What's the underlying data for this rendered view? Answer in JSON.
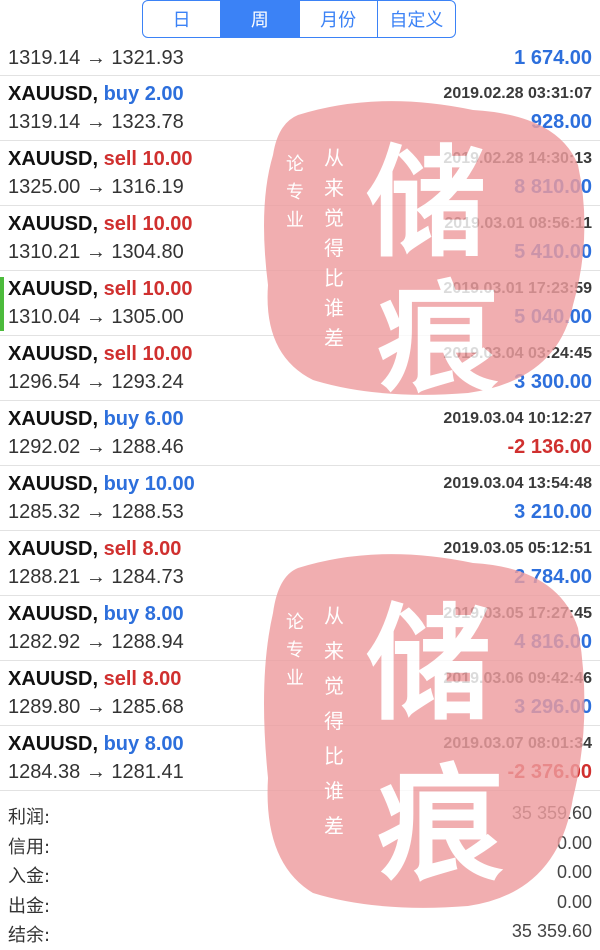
{
  "tabs": [
    "日",
    "周",
    "月份",
    "自定义"
  ],
  "active_tab": 1,
  "first_row": {
    "prices": "1319.14 → 1321.93",
    "profit": "1 674.00"
  },
  "trades": [
    {
      "symbol": "XAUUSD,",
      "action": "buy",
      "lots": "2.00",
      "time": "2019.02.28 03:31:07",
      "open": "1319.14",
      "close": "1323.78",
      "profit": "928.00",
      "sign": "pos"
    },
    {
      "symbol": "XAUUSD,",
      "action": "sell",
      "lots": "10.00",
      "time": "2019.02.28 14:30:13",
      "open": "1325.00",
      "close": "1316.19",
      "profit": "8 810.00",
      "sign": "pos"
    },
    {
      "symbol": "XAUUSD,",
      "action": "sell",
      "lots": "10.00",
      "time": "2019.03.01 08:56:11",
      "open": "1310.21",
      "close": "1304.80",
      "profit": "5 410.00",
      "sign": "pos"
    },
    {
      "symbol": "XAUUSD,",
      "action": "sell",
      "lots": "10.00",
      "time": "2019.03.01 17:23:59",
      "open": "1310.04",
      "close": "1305.00",
      "profit": "5 040.00",
      "sign": "pos",
      "selected": true
    },
    {
      "symbol": "XAUUSD,",
      "action": "sell",
      "lots": "10.00",
      "time": "2019.03.04 03:24:45",
      "open": "1296.54",
      "close": "1293.24",
      "profit": "3 300.00",
      "sign": "pos"
    },
    {
      "symbol": "XAUUSD,",
      "action": "buy",
      "lots": "6.00",
      "time": "2019.03.04 10:12:27",
      "open": "1292.02",
      "close": "1288.46",
      "profit": "-2 136.00",
      "sign": "neg"
    },
    {
      "symbol": "XAUUSD,",
      "action": "buy",
      "lots": "10.00",
      "time": "2019.03.04 13:54:48",
      "open": "1285.32",
      "close": "1288.53",
      "profit": "3 210.00",
      "sign": "pos"
    },
    {
      "symbol": "XAUUSD,",
      "action": "sell",
      "lots": "8.00",
      "time": "2019.03.05 05:12:51",
      "open": "1288.21",
      "close": "1284.73",
      "profit": "2 784.00",
      "sign": "pos"
    },
    {
      "symbol": "XAUUSD,",
      "action": "buy",
      "lots": "8.00",
      "time": "2019.03.05 17:27:45",
      "open": "1282.92",
      "close": "1288.94",
      "profit": "4 816.00",
      "sign": "pos"
    },
    {
      "symbol": "XAUUSD,",
      "action": "sell",
      "lots": "8.00",
      "time": "2019.03.06 09:42:46",
      "open": "1289.80",
      "close": "1285.68",
      "profit": "3 296.00",
      "sign": "pos"
    },
    {
      "symbol": "XAUUSD,",
      "action": "buy",
      "lots": "8.00",
      "time": "2019.03.07 08:01:34",
      "open": "1284.38",
      "close": "1281.41",
      "profit": "-2 376.00",
      "sign": "neg"
    }
  ],
  "summary": [
    {
      "label": "利润:",
      "value": "35 359.60"
    },
    {
      "label": "信用:",
      "value": "0.00"
    },
    {
      "label": "入金:",
      "value": "0.00"
    },
    {
      "label": "出金:",
      "value": "0.00"
    },
    {
      "label": "结余:",
      "value": "35 359.60"
    }
  ],
  "watermark": {
    "big": [
      "储",
      "痕"
    ],
    "small_right": "从来觉得比谁差",
    "small_left": "论专业"
  },
  "colors": {
    "tab_accent": "#3b82f6",
    "buy": "#2d6fdc",
    "sell": "#d0302f",
    "selected_marker": "#4cbb3c",
    "seal": "#ee9d9f"
  }
}
